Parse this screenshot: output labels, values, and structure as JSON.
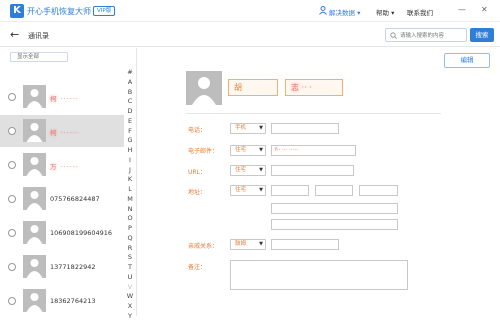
{
  "app": {
    "logo_letter": "K",
    "title": "开心手机恢复大师",
    "vip_tag": "VIP版",
    "user_menu": "解决数据",
    "help_menu": "帮助",
    "contact_menu": "联系我们",
    "win_minimize": "—",
    "win_close": "✕"
  },
  "nav": {
    "back_icon": "←",
    "title": "通讯录",
    "search_placeholder": "请输入搜索的内容",
    "search_button": "搜索"
  },
  "contacts": {
    "filter_label": "显示全部",
    "items": [
      {
        "name": "柯 ······",
        "blurred": true,
        "selected": false
      },
      {
        "name": "柯 ······",
        "blurred": true,
        "selected": true
      },
      {
        "name": "万 ······",
        "blurred": true,
        "selected": false
      },
      {
        "name": "075766824487",
        "blurred": false,
        "selected": false
      },
      {
        "name": "106908199604916",
        "blurred": false,
        "selected": false
      },
      {
        "name": "13771822942",
        "blurred": false,
        "selected": false
      },
      {
        "name": "18362764213",
        "blurred": false,
        "selected": false
      }
    ],
    "alphabet": [
      "#",
      "A",
      "B",
      "C",
      "D",
      "E",
      "F",
      "G",
      "H",
      "I",
      "J",
      "K",
      "L",
      "M",
      "N",
      "O",
      "P",
      "Q",
      "R",
      "S",
      "T",
      "U",
      "V",
      "W",
      "X",
      "Y"
    ]
  },
  "detail": {
    "edit_button": "编辑",
    "last_name": "胡",
    "first_name": "志 ·· ·",
    "labels": {
      "phone": "电话：",
      "email": "电子邮件：",
      "url": "URL：",
      "address": "地址：",
      "relation": "亲戚关系：",
      "note": "备注："
    },
    "selects": {
      "phone_type": "手机",
      "email_type": "住宅",
      "url_type": "住宅",
      "address_type": "住宅",
      "relation_type": "鼓姆"
    },
    "email_value": "f·· ··· ·····"
  },
  "colors": {
    "accent": "#2f7fd9",
    "label_orange": "#e57b36",
    "selected_row": "#e0e0e0"
  }
}
